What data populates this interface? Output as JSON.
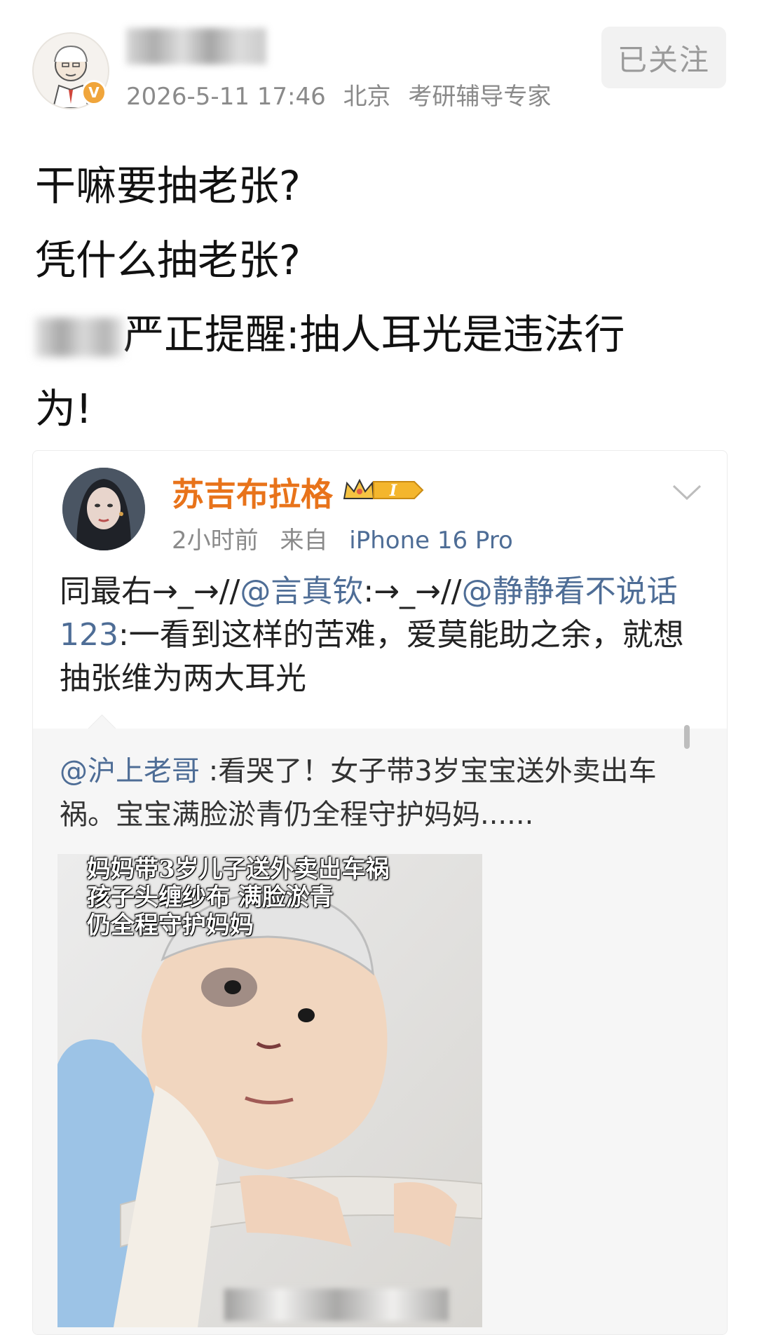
{
  "header": {
    "timestamp": "2026-5-11 17:46",
    "location": "北京",
    "tag": "考研辅导专家",
    "verified_badge": "V",
    "follow_label": "已关注"
  },
  "post": {
    "line1": "干嘛要抽老张?",
    "line2": "凭什么抽老张?",
    "line3": "严正提醒:抽人耳光是违法行",
    "line4": "为!"
  },
  "repost_card": {
    "author": "苏吉布拉格",
    "level_badge": "I",
    "time": "2小时前",
    "source_prefix": "来自",
    "device": "iPhone 16 Pro",
    "text_part1": "同最右→_→//",
    "mention1": "@言真钦",
    "text_part2": ":→_→//",
    "mention2": "@静静看不说话123",
    "text_part3": ":一看到这样的苦难，爱莫能助之余，就想抽张维为两大耳光"
  },
  "quoted_post": {
    "mention": "@沪上老哥",
    "text": " :看哭了！女子带3岁宝宝送外卖出车祸。宝宝满脸淤青仍全程守护妈妈......"
  },
  "video": {
    "caption_line1": "妈妈带3岁儿子送外卖出车祸",
    "caption_line2": "孩子头缠纱布 满脸淤青",
    "caption_line3": "仍全程守护妈妈"
  },
  "colors": {
    "author_orange": "#e8731a",
    "link_blue": "#4e6d96",
    "meta_gray": "#8a8a8a",
    "verified_gold": "#f0a53b",
    "quoted_bg": "#f6f6f6"
  },
  "icons": [
    "avatar",
    "verified-badge-icon",
    "crown-level-icon",
    "chevron-down-icon"
  ]
}
